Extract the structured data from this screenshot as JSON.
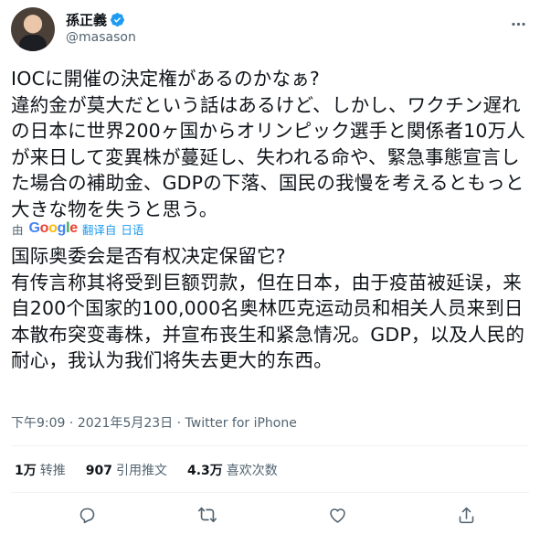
{
  "user": {
    "display_name": "孫正義",
    "handle": "@masason",
    "verified": true
  },
  "tweet": {
    "text": "IOCに開催の決定権があるのかなぁ?\n違約金が莫大だという話はあるけど、しかし、ワクチン遅れの日本に世界200ヶ国からオリンピック選手と関係者10万人が来日して変異株が蔓延し、失われる命や、緊急事態宣言した場合の補助金、GDPの下落、国民の我慢を考えるともっと大きな物を失うと思う。"
  },
  "translation": {
    "prefix": "由",
    "provider": "Google",
    "link_label": "翻译自",
    "language": "日语",
    "text": "国际奥委会是否有权决定保留它?\n有传言称其将受到巨额罚款，但在日本，由于疫苗被延误，来自200个国家的100,000名奥林匹克运动员和相关人员来到日本散布突变毒株，并宣布丧生和紧急情况。GDP，以及人民的耐心，我认为我们将失去更大的东西。"
  },
  "meta": {
    "time": "下午9:09",
    "separator1": "·",
    "date": "2021年5月23日",
    "separator2": "·",
    "source": "Twitter for iPhone"
  },
  "stats": {
    "retweets_count": "1万",
    "retweets_label": "转推",
    "quotes_count": "907",
    "quotes_label": "引用推文",
    "likes_count": "4.3万",
    "likes_label": "喜欢次数"
  },
  "icons": {
    "more": "more-icon",
    "reply": "reply-icon",
    "retweet": "retweet-icon",
    "like": "heart-icon",
    "share": "share-icon",
    "verified": "verified-badge-icon"
  },
  "colors": {
    "text": "#0f1419",
    "secondary": "#536471",
    "accent": "#1d9bf0"
  }
}
